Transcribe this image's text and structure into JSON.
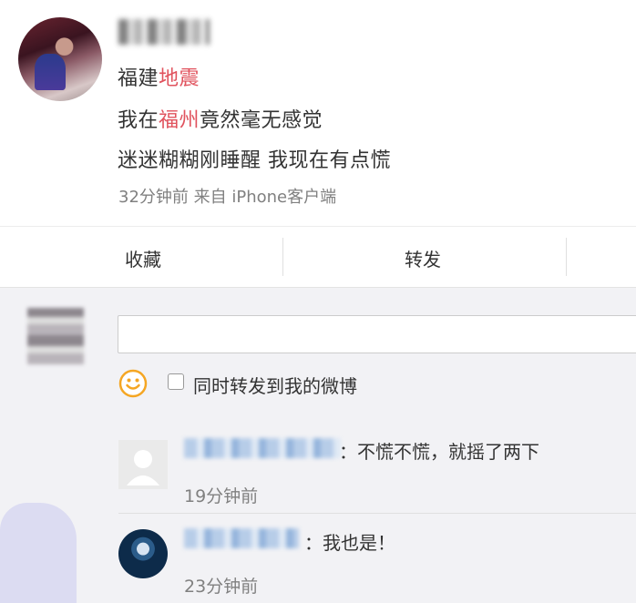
{
  "post": {
    "lines": [
      [
        {
          "text": "福建",
          "highlight": false
        },
        {
          "text": "地震",
          "highlight": true
        }
      ],
      [
        {
          "text": "我在",
          "highlight": false
        },
        {
          "text": "福州",
          "highlight": true
        },
        {
          "text": "竟然毫无感觉",
          "highlight": false
        }
      ],
      [
        {
          "text": "迷迷糊糊刚睡醒 我现在有点慌",
          "highlight": false
        }
      ]
    ],
    "meta": "32分钟前 来自 iPhone客户端",
    "highlight_color": "#e0525d"
  },
  "actions": {
    "favorite_label": "收藏",
    "forward_label": "转发"
  },
  "composer": {
    "input_value": "",
    "forward_checkbox_label": "同时转发到我的微博",
    "forward_checked": false,
    "emoji_icon": "smile-icon"
  },
  "comments": [
    {
      "text": "：不慌不慌，就摇了两下",
      "time": "19分钟前",
      "avatar": "default-avatar-icon"
    },
    {
      "text": "：我也是！",
      "time": "23分钟前",
      "avatar": "user-avatar"
    }
  ]
}
